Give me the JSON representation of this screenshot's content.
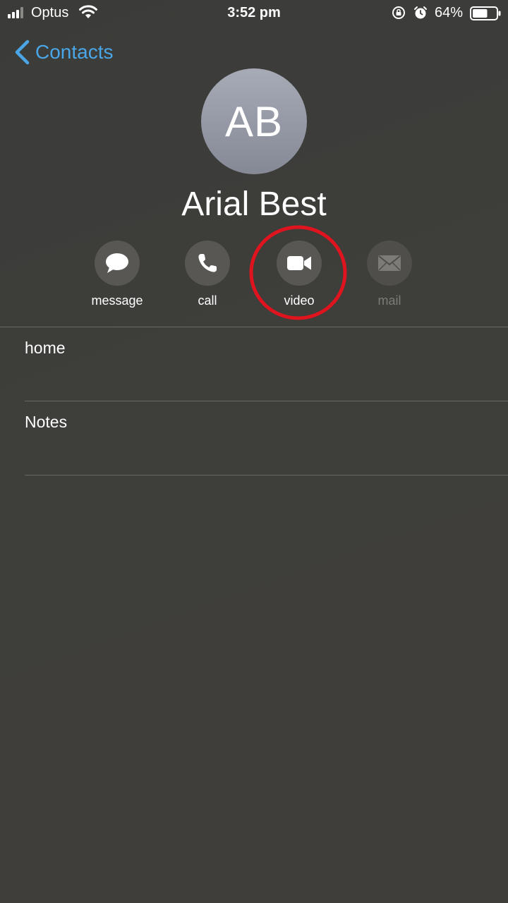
{
  "status": {
    "carrier": "Optus",
    "time": "3:52 pm",
    "battery_pct": "64%",
    "battery_level": 0.64
  },
  "nav": {
    "back_label": "Contacts"
  },
  "contact": {
    "initials": "AB",
    "name": "Arial Best"
  },
  "actions": [
    {
      "label": "message",
      "icon": "message-bubble-icon",
      "enabled": true
    },
    {
      "label": "call",
      "icon": "phone-icon",
      "enabled": true
    },
    {
      "label": "video",
      "icon": "video-camera-icon",
      "enabled": true
    },
    {
      "label": "mail",
      "icon": "envelope-icon",
      "enabled": false
    }
  ],
  "rows": [
    {
      "label": "home"
    },
    {
      "label": "Notes"
    }
  ],
  "colors": {
    "accent": "#4aa6e6",
    "highlight": "#e0141e",
    "background": "#3e3d3a"
  }
}
